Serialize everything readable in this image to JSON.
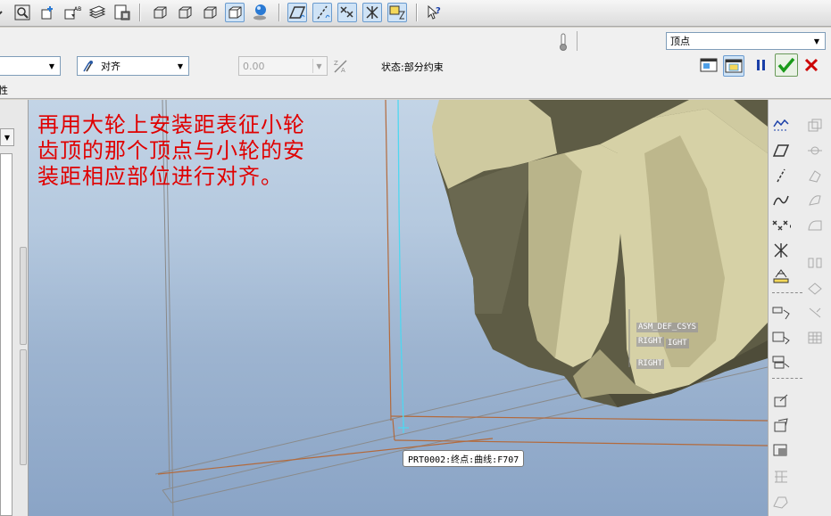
{
  "dashboard": {
    "constraint_type": "对齐",
    "offset_value": "0.00",
    "status_label": "状态:部分约束",
    "reference_type": "顶点",
    "left_label": "性"
  },
  "viewport": {
    "annotation_lines": [
      "再用大轮上安装距表征小轮",
      "齿顶的那个顶点与小轮的安",
      "装距相应部位进行对齐。"
    ],
    "tooltip": "PRT0002:终点:曲线:F707",
    "datum_labels": {
      "csys": "ASM_DEF_CSYS",
      "right_1": "RIGHT",
      "right_2": "IGHT",
      "right_3": "RIGHT"
    }
  },
  "colors": {
    "annotation": "#e00000",
    "gear_face": "#d6d1a6",
    "gear_shadow": "#5e5c45",
    "confirm_green": "#1a9a1a",
    "cancel_red": "#cc0000",
    "datum_curve": "#4fd7f0",
    "datum_plane_edge": "#b36a3c"
  },
  "icons": {
    "top_toolbar": [
      "zoom-window-icon",
      "zoom-fit-icon",
      "reorient-icon",
      "saved-views-icon",
      "layers-icon",
      "view-manager-icon",
      "wireframe-icon",
      "hidden-line-icon",
      "no-hidden-icon",
      "shading-icon",
      "appearance-icon",
      "datum-plane-display-icon",
      "datum-axis-display-icon",
      "datum-point-display-icon",
      "csys-display-icon",
      "annotation-display-icon",
      "context-help-icon"
    ],
    "dashboard_right": [
      "separate-window-icon",
      "assembly-window-icon",
      "pause-icon",
      "confirm-icon",
      "cancel-icon"
    ],
    "right_toolbar": [
      "sketch-icon",
      "datum-plane-icon",
      "datum-axis-icon",
      "datum-curve-icon",
      "datum-point-icon",
      "csys-icon",
      "analysis-icon",
      "copy-geometry-icon",
      "mirror-icon",
      "extrude-icon",
      "revolve-icon",
      "sweep-icon",
      "blend-icon",
      "pattern-icon",
      "merge-icon",
      "trim-icon",
      "offset-icon",
      "thicken-icon",
      "solidify-icon",
      "view-front-icon",
      "view-rotate-icon",
      "view-section-icon"
    ]
  }
}
